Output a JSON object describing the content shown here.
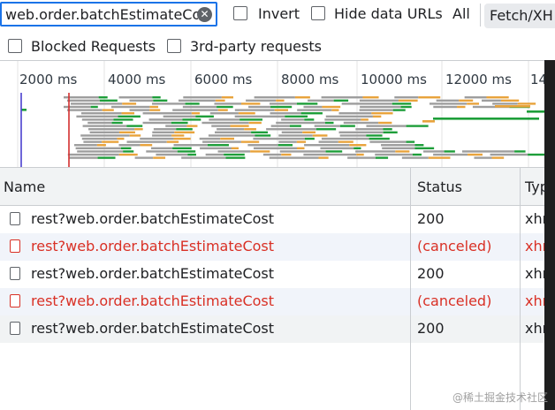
{
  "filter": {
    "search_value": "web.order.batchEstimateCo",
    "invert_label": "Invert",
    "hide_data_urls_label": "Hide data URLs",
    "all_label": "All",
    "fetch_xhr_label": "Fetch/XH",
    "blocked_requests_label": "Blocked Requests",
    "third_party_label": "3rd-party requests"
  },
  "overview": {
    "ticks": [
      {
        "label": "2000 ms"
      },
      {
        "label": "4000 ms"
      },
      {
        "label": "6000 ms"
      },
      {
        "label": "8000 ms"
      },
      {
        "label": "10000 ms"
      },
      {
        "label": "12000 ms"
      },
      {
        "label": "14"
      }
    ],
    "colors": {
      "waiting": "#9e9e9e",
      "download": "#1e9e3a",
      "queued": "#e8a33c",
      "dom_content_loaded": "#4a3fcf",
      "load": "#d32f2f"
    }
  },
  "table": {
    "columns": [
      "Name",
      "Status",
      "Typ"
    ],
    "rows": [
      {
        "name": "rest?web.order.batchEstimateCost",
        "status": "200",
        "type": "xhr",
        "error": false
      },
      {
        "name": "rest?web.order.batchEstimateCost",
        "status": "(canceled)",
        "type": "xhr",
        "error": true
      },
      {
        "name": "rest?web.order.batchEstimateCost",
        "status": "200",
        "type": "xhr",
        "error": false
      },
      {
        "name": "rest?web.order.batchEstimateCost",
        "status": "(canceled)",
        "type": "xhr",
        "error": true
      },
      {
        "name": "rest?web.order.batchEstimateCost",
        "status": "200",
        "type": "xhr",
        "error": false
      }
    ]
  },
  "watermark": "@稀土掘金技术社区"
}
